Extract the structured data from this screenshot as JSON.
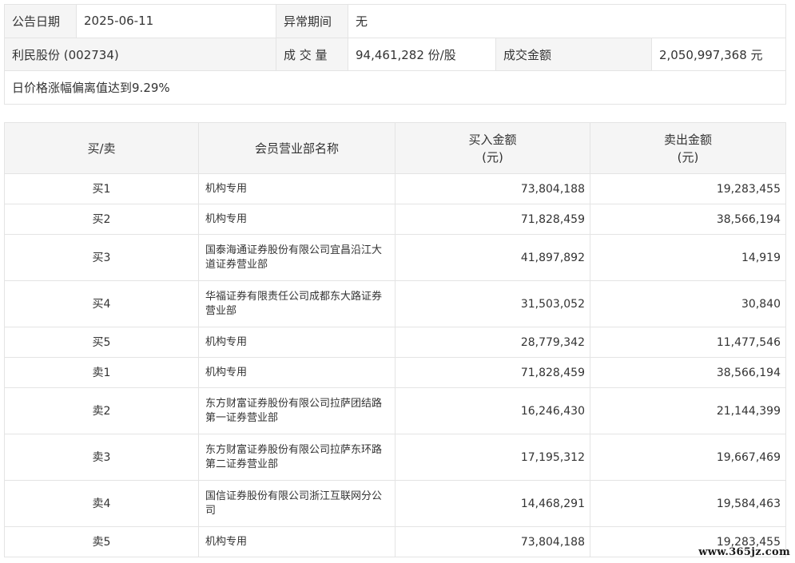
{
  "info": {
    "announce_date_label": "公告日期",
    "announce_date_value": "2025-06-11",
    "abnormal_period_label": "异常期间",
    "abnormal_period_value": "无",
    "stock_name": "利民股份 (002734)",
    "volume_label": "成 交 量",
    "volume_value": "94,461,282 份/股",
    "amount_label": "成交金额",
    "amount_value": "2,050,997,368 元",
    "reason": "日价格涨幅偏离值达到9.29%"
  },
  "table": {
    "headers": {
      "side": "买/卖",
      "member": "会员营业部名称",
      "buy_line1": "买入金额",
      "buy_line2": "(元)",
      "sell_line1": "卖出金额",
      "sell_line2": "(元)"
    },
    "rows": [
      {
        "side": "买1",
        "name": "机构专用",
        "buy": "73,804,188",
        "sell": "19,283,455"
      },
      {
        "side": "买2",
        "name": "机构专用",
        "buy": "71,828,459",
        "sell": "38,566,194"
      },
      {
        "side": "买3",
        "name": "国泰海通证券股份有限公司宜昌沿江大道证券营业部",
        "buy": "41,897,892",
        "sell": "14,919"
      },
      {
        "side": "买4",
        "name": "华福证券有限责任公司成都东大路证券营业部",
        "buy": "31,503,052",
        "sell": "30,840"
      },
      {
        "side": "买5",
        "name": "机构专用",
        "buy": "28,779,342",
        "sell": "11,477,546"
      },
      {
        "side": "卖1",
        "name": "机构专用",
        "buy": "71,828,459",
        "sell": "38,566,194"
      },
      {
        "side": "卖2",
        "name": "东方财富证券股份有限公司拉萨团结路第一证券营业部",
        "buy": "16,246,430",
        "sell": "21,144,399"
      },
      {
        "side": "卖3",
        "name": "东方财富证券股份有限公司拉萨东环路第二证券营业部",
        "buy": "17,195,312",
        "sell": "19,667,469"
      },
      {
        "side": "卖4",
        "name": "国信证券股份有限公司浙江互联网分公司",
        "buy": "14,468,291",
        "sell": "19,584,463"
      },
      {
        "side": "卖5",
        "name": "机构专用",
        "buy": "73,804,188",
        "sell": "19,283,455"
      }
    ]
  },
  "watermark": "www.365jz.com"
}
